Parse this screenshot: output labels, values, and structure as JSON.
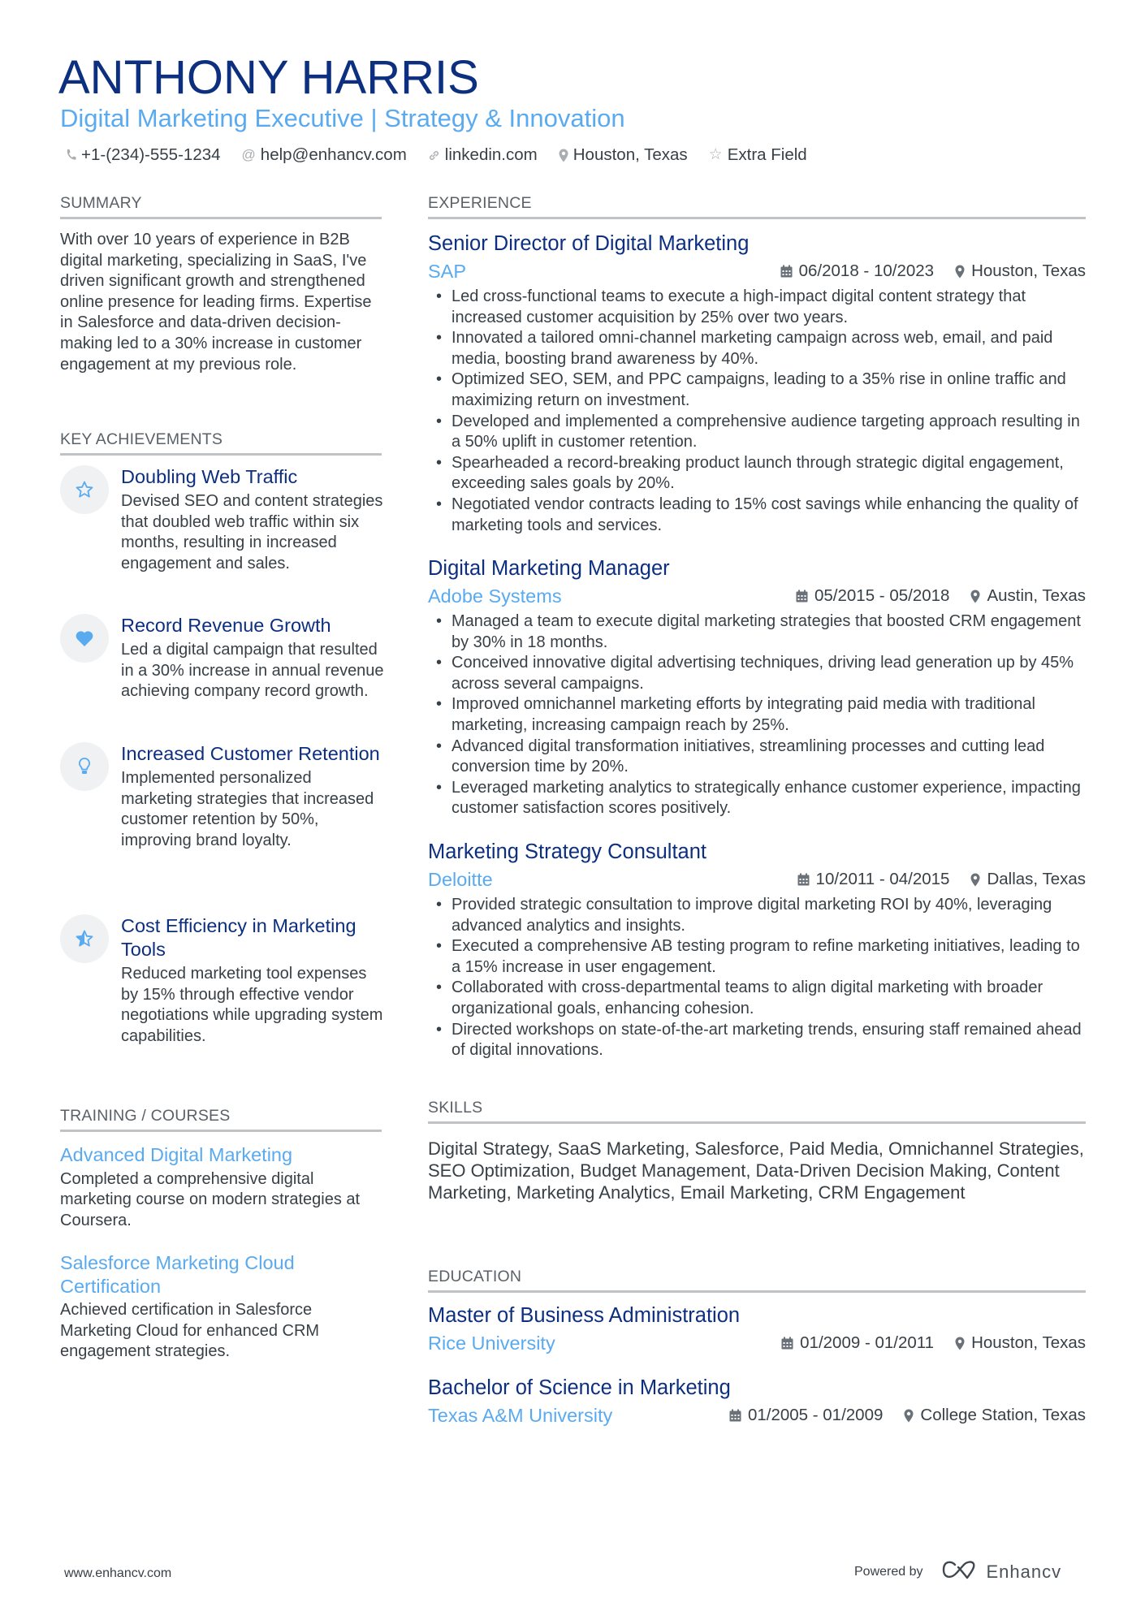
{
  "header": {
    "name": "ANTHONY HARRIS",
    "subtitle": "Digital Marketing Executive | Strategy & Innovation",
    "contacts": [
      {
        "icon": "phone-icon",
        "text": "+1-(234)-555-1234"
      },
      {
        "icon": "at-icon",
        "text": "help@enhancv.com"
      },
      {
        "icon": "link-icon",
        "text": "linkedin.com"
      },
      {
        "icon": "location-icon",
        "text": "Houston, Texas"
      },
      {
        "icon": "star-icon",
        "text": "Extra Field"
      }
    ]
  },
  "summary": {
    "heading": "SUMMARY",
    "text": "With over 10 years of experience in B2B digital marketing, specializing in SaaS, I've driven significant growth and strengthened online presence for leading firms. Expertise in Salesforce and data-driven decision-making led to a 30% increase in customer engagement at my previous role."
  },
  "achievements": {
    "heading": "KEY ACHIEVEMENTS",
    "items": [
      {
        "icon": "star-outline-icon",
        "title": "Doubling Web Traffic",
        "desc": "Devised SEO and content strategies that doubled web traffic within six months, resulting in increased engagement and sales."
      },
      {
        "icon": "heart-icon",
        "title": "Record Revenue Growth",
        "desc": "Led a digital campaign that resulted in a 30% increase in annual revenue achieving company record growth."
      },
      {
        "icon": "lightbulb-icon",
        "title": "Increased Customer Retention",
        "desc": "Implemented personalized marketing strategies that increased customer retention by 50%, improving brand loyalty."
      },
      {
        "icon": "half-star-icon",
        "title": "Cost Efficiency in Marketing Tools",
        "desc": "Reduced marketing tool expenses by 15% through effective vendor negotiations while upgrading system capabilities."
      }
    ]
  },
  "training": {
    "heading": "TRAINING / COURSES",
    "items": [
      {
        "title": "Advanced Digital Marketing",
        "desc": "Completed a comprehensive digital marketing course on modern strategies at Coursera."
      },
      {
        "title": "Salesforce Marketing Cloud Certification",
        "desc": "Achieved certification in Salesforce Marketing Cloud for enhanced CRM engagement strategies."
      }
    ]
  },
  "experience": {
    "heading": "EXPERIENCE",
    "jobs": [
      {
        "role": "Senior Director of Digital Marketing",
        "company": "SAP",
        "dates": "06/2018 - 10/2023",
        "location": "Houston, Texas",
        "bullets": [
          "Led cross-functional teams to execute a high-impact digital content strategy that increased customer acquisition by 25% over two years.",
          "Innovated a tailored omni-channel marketing campaign across web, email, and paid media, boosting brand awareness by 40%.",
          "Optimized SEO, SEM, and PPC campaigns, leading to a 35% rise in online traffic and maximizing return on investment.",
          "Developed and implemented a comprehensive audience targeting approach resulting in a 50% uplift in customer retention.",
          "Spearheaded a record-breaking product launch through strategic digital engagement, exceeding sales goals by 20%.",
          "Negotiated vendor contracts leading to 15% cost savings while enhancing the quality of marketing tools and services."
        ]
      },
      {
        "role": "Digital Marketing Manager",
        "company": "Adobe Systems",
        "dates": "05/2015 - 05/2018",
        "location": "Austin, Texas",
        "bullets": [
          "Managed a team to execute digital marketing strategies that boosted CRM engagement by 30% in 18 months.",
          "Conceived innovative digital advertising techniques, driving lead generation up by 45% across several campaigns.",
          "Improved omnichannel marketing efforts by integrating paid media with traditional marketing, increasing campaign reach by 25%.",
          "Advanced digital transformation initiatives, streamlining processes and cutting lead conversion time by 20%.",
          "Leveraged marketing analytics to strategically enhance customer experience, impacting customer satisfaction scores positively."
        ]
      },
      {
        "role": "Marketing Strategy Consultant",
        "company": "Deloitte",
        "dates": "10/2011 - 04/2015",
        "location": "Dallas, Texas",
        "bullets": [
          "Provided strategic consultation to improve digital marketing ROI by 40%, leveraging advanced analytics and insights.",
          "Executed a comprehensive AB testing program to refine marketing initiatives, leading to a 15% increase in user engagement.",
          "Collaborated with cross-departmental teams to align digital marketing with broader organizational goals, enhancing cohesion.",
          "Directed workshops on state-of-the-art marketing trends, ensuring staff remained ahead of digital innovations."
        ]
      }
    ]
  },
  "skills": {
    "heading": "SKILLS",
    "text": "Digital Strategy, SaaS Marketing, Salesforce, Paid Media, Omnichannel Strategies, SEO Optimization, Budget Management, Data-Driven Decision Making, Content Marketing, Marketing Analytics, Email Marketing, CRM Engagement"
  },
  "education": {
    "heading": "EDUCATION",
    "items": [
      {
        "degree": "Master of Business Administration",
        "school": "Rice University",
        "dates": "01/2009 - 01/2011",
        "location": "Houston, Texas"
      },
      {
        "degree": "Bachelor of Science in Marketing",
        "school": "Texas A&M University",
        "dates": "01/2005 - 01/2009",
        "location": "College Station, Texas"
      }
    ]
  },
  "footer": {
    "website": "www.enhancv.com",
    "powered_by": "Powered by",
    "brand": "Enhancv"
  },
  "colors": {
    "name": "#0d2f80",
    "accent": "#5aaaf0",
    "text": "#384047",
    "rule": "#c0c3c6",
    "icon_bg": "#f0f1f2"
  }
}
